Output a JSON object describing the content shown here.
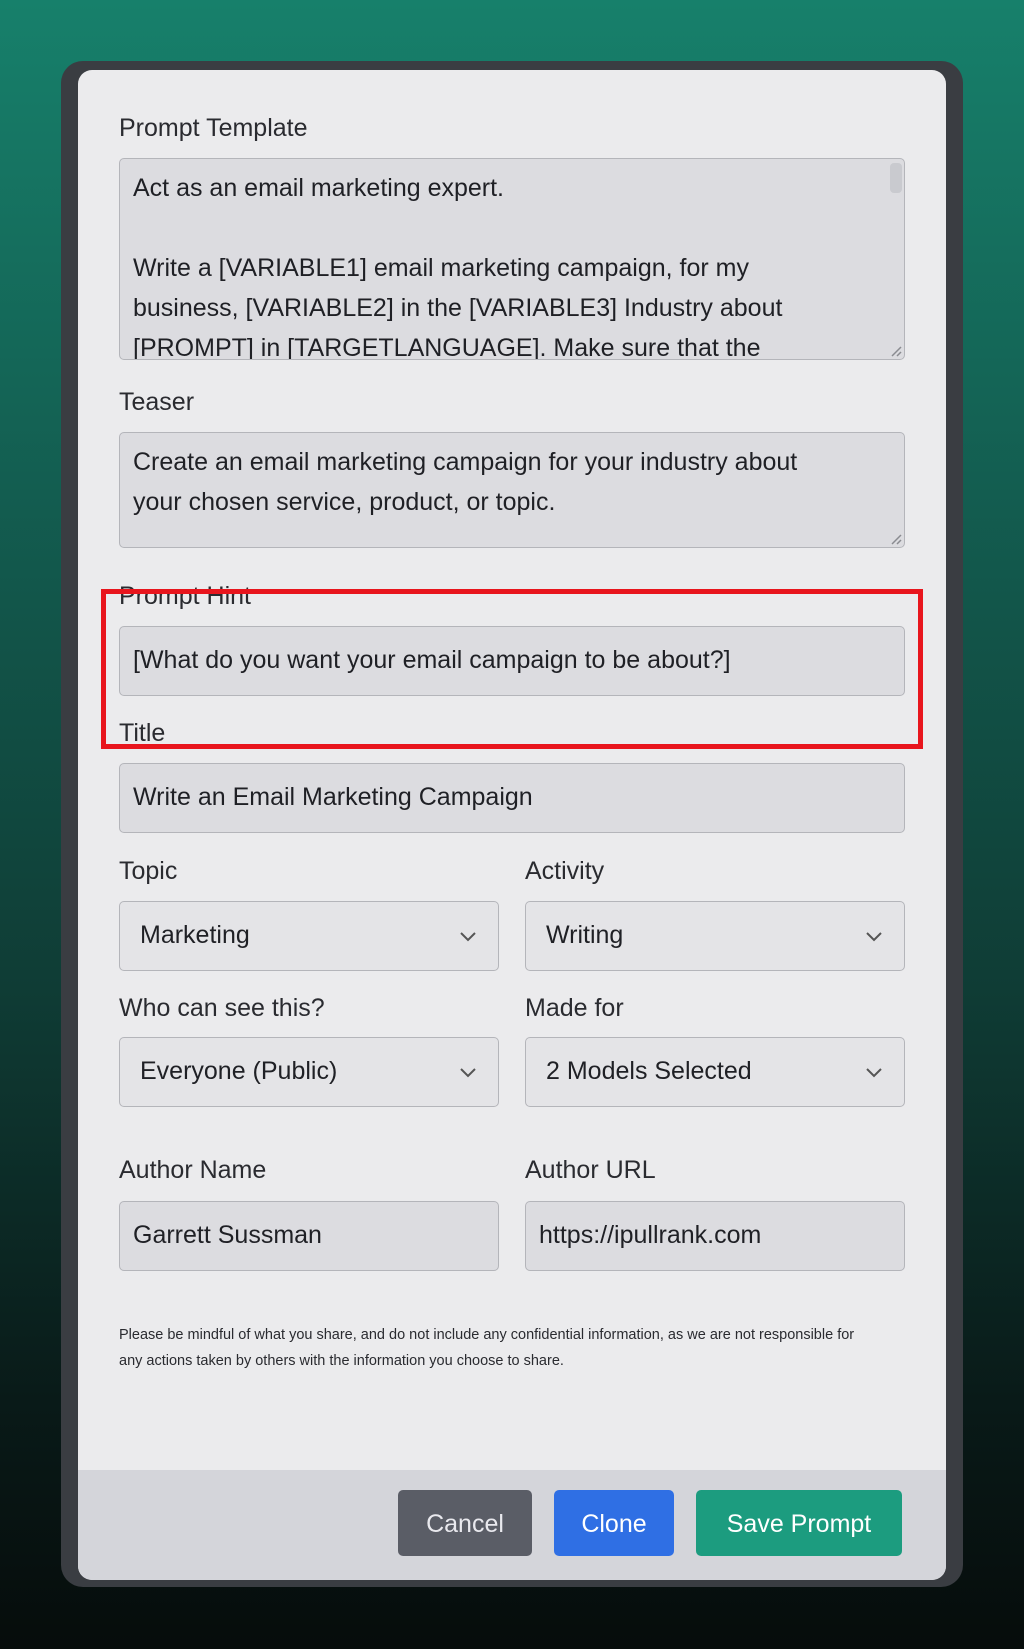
{
  "form": {
    "prompt_template": {
      "label": "Prompt Template",
      "lines": [
        "Act as an email marketing expert.",
        "",
        "Write a [VARIABLE1] email marketing campaign, for my",
        "business, [VARIABLE2] in the [VARIABLE3] Industry about",
        "[PROMPT] in [TARGETLANGUAGE]. Make sure that the"
      ]
    },
    "teaser": {
      "label": "Teaser",
      "lines": [
        "Create an email marketing campaign for your industry about",
        "your chosen service, product, or topic."
      ]
    },
    "prompt_hint": {
      "label": "Prompt Hint",
      "value": "[What do you want your email campaign to be about?]"
    },
    "title": {
      "label": "Title",
      "value": "Write an Email Marketing Campaign"
    },
    "topic": {
      "label": "Topic",
      "selected": "Marketing"
    },
    "activity": {
      "label": "Activity",
      "selected": "Writing"
    },
    "visibility": {
      "label": "Who can see this?",
      "selected": "Everyone (Public)"
    },
    "made_for": {
      "label": "Made for",
      "selected": "2 Models Selected"
    },
    "author_name": {
      "label": "Author Name",
      "value": "Garrett Sussman"
    },
    "author_url": {
      "label": "Author URL",
      "value": "https://ipullrank.com"
    },
    "disclaimer": "Please be mindful of what you share, and do not include any confidential information, as we are not responsible for any actions taken by others with the information you choose to share."
  },
  "buttons": {
    "cancel": "Cancel",
    "clone": "Clone",
    "save": "Save Prompt"
  },
  "colors": {
    "highlight": "#e8151d",
    "cancel": "#5a5d66",
    "clone": "#2f6fe4",
    "save": "#1c9c7f"
  },
  "icons": {
    "select_chevron": "chevron-down-icon",
    "textarea_resize": "resize-grip-icon"
  }
}
